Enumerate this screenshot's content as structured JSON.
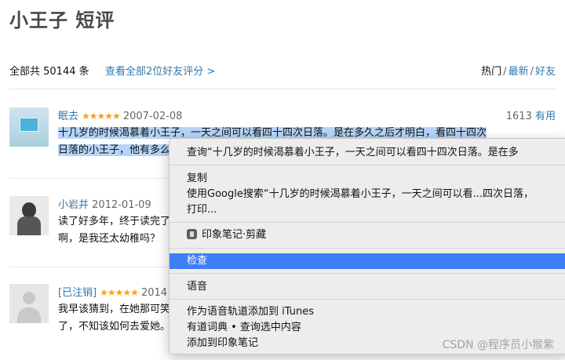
{
  "page": {
    "title": "小王子 短评",
    "summary": "全部共 50144 条",
    "friends_link": "查看全部2位好友评分 >",
    "sort": [
      "热门",
      "最新",
      "好友"
    ]
  },
  "reviews": [
    {
      "user": "眠去",
      "stars": "★★★★★",
      "date": "2007-02-08",
      "useful_count": "1613",
      "useful_label": "有用",
      "text_line1": "十几岁的时候渴慕着小王子，一天之间可以看四十四次日落。是在多久之后才明白，看四十四次",
      "text_line2": "日落的小王子，他有多么"
    },
    {
      "user": "小岩井",
      "stars": "",
      "date": "2012-01-09",
      "text_line1": "读了好多年，终于读完了",
      "text_line2": "啊，是我还太幼稚吗？"
    },
    {
      "user": "[已注销]",
      "stars": "★★★★★",
      "date": "2014",
      "text_line1": "我早该猜到，在她那可笑",
      "text_line2": "了，不知该如何去爱她。"
    }
  ],
  "context_menu": {
    "lookup": "查询“十几岁的时候渴慕着小王子，一天之间可以看四十四次日落。是在多",
    "copy": "复制",
    "google_search": "使用Google搜索“十几岁的时候渴慕着小王子，一天之间可以看...四次日落，",
    "print": "打印...",
    "evernote_clip": "印象笔记·剪藏",
    "inspect": "检查",
    "speech": "语音",
    "add_itunes": "作为语音轨道添加到 iTunes",
    "youdao": "有道词典 • 查询选中内容",
    "add_evernote": "添加到印象笔记"
  },
  "watermark": "CSDN @程序员小猴紫"
}
